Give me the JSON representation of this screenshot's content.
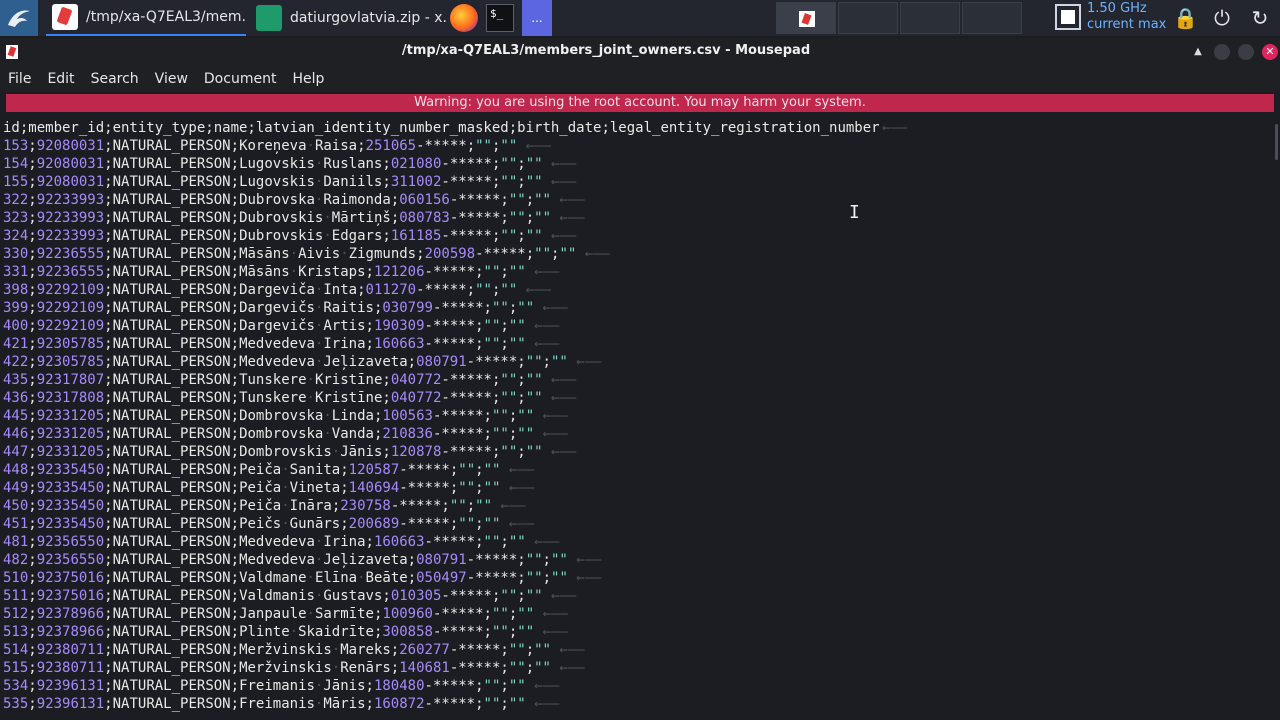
{
  "taskbar": {
    "tasks": [
      {
        "label": "/tmp/xa-Q7EAL3/mem..."
      },
      {
        "label": "datiurgovlatvia.zip - x..."
      }
    ],
    "terminal_glyph": "$_",
    "extra_label": "...",
    "cpu_freq": "1.50 GHz",
    "cpu_mode": "current max",
    "icons": [
      "kali-dragon-icon",
      "mousepad-icon",
      "archive-icon",
      "firefox-icon",
      "terminal-icon",
      "lock-icon",
      "power-icon",
      "refresh-icon"
    ]
  },
  "window": {
    "title": "/tmp/xa-Q7EAL3/members_joint_owners.csv - Mousepad"
  },
  "menu": [
    "File",
    "Edit",
    "Search",
    "View",
    "Document",
    "Help"
  ],
  "warning": "Warning: you are using the root account. You may harm your system.",
  "editor": {
    "header": "id;member_id;entity_type;name;latvian_identity_number_masked;birth_date;legal_entity_registration_number",
    "rows": [
      [
        "153",
        "92080031",
        "NATURAL_PERSON",
        "Koreņeva Raisa",
        "251065-*****"
      ],
      [
        "154",
        "92080031",
        "NATURAL_PERSON",
        "Lugovskis Ruslans",
        "021080-*****"
      ],
      [
        "155",
        "92080031",
        "NATURAL_PERSON",
        "Lugovskis Daniils",
        "311002-*****"
      ],
      [
        "322",
        "92233993",
        "NATURAL_PERSON",
        "Dubrovska Raimonda",
        "060156-*****"
      ],
      [
        "323",
        "92233993",
        "NATURAL_PERSON",
        "Dubrovskis Mārtiņš",
        "080783-*****"
      ],
      [
        "324",
        "92233993",
        "NATURAL_PERSON",
        "Dubrovskis Edgars",
        "161185-*****"
      ],
      [
        "330",
        "92236555",
        "NATURAL_PERSON",
        "Māsāns Aivis Zigmunds",
        "200598-*****"
      ],
      [
        "331",
        "92236555",
        "NATURAL_PERSON",
        "Māsāns Kristaps",
        "121206-*****"
      ],
      [
        "398",
        "92292109",
        "NATURAL_PERSON",
        "Dargeviča Inta",
        "011270-*****"
      ],
      [
        "399",
        "92292109",
        "NATURAL_PERSON",
        "Dargevičs Raitis",
        "030799-*****"
      ],
      [
        "400",
        "92292109",
        "NATURAL_PERSON",
        "Dargevičs Artis",
        "190309-*****"
      ],
      [
        "421",
        "92305785",
        "NATURAL_PERSON",
        "Medvedeva Irina",
        "160663-*****"
      ],
      [
        "422",
        "92305785",
        "NATURAL_PERSON",
        "Medvedeva Jeļizaveta",
        "080791-*****"
      ],
      [
        "435",
        "92317807",
        "NATURAL_PERSON",
        "Tunskere Kristīne",
        "040772-*****"
      ],
      [
        "436",
        "92317808",
        "NATURAL_PERSON",
        "Tunskere Kristīne",
        "040772-*****"
      ],
      [
        "445",
        "92331205",
        "NATURAL_PERSON",
        "Dombrovska Linda",
        "100563-*****"
      ],
      [
        "446",
        "92331205",
        "NATURAL_PERSON",
        "Dombrovska Vanda",
        "210836-*****"
      ],
      [
        "447",
        "92331205",
        "NATURAL_PERSON",
        "Dombrovskis Jānis",
        "120878-*****"
      ],
      [
        "448",
        "92335450",
        "NATURAL_PERSON",
        "Peiča Sanita",
        "120587-*****"
      ],
      [
        "449",
        "92335450",
        "NATURAL_PERSON",
        "Peiča Vineta",
        "140694-*****"
      ],
      [
        "450",
        "92335450",
        "NATURAL_PERSON",
        "Peiča Ināra",
        "230758-*****"
      ],
      [
        "451",
        "92335450",
        "NATURAL_PERSON",
        "Peičs Gunārs",
        "200689-*****"
      ],
      [
        "481",
        "92356550",
        "NATURAL_PERSON",
        "Medvedeva Irina",
        "160663-*****"
      ],
      [
        "482",
        "92356550",
        "NATURAL_PERSON",
        "Medvedeva Jeļizaveta",
        "080791-*****"
      ],
      [
        "510",
        "92375016",
        "NATURAL_PERSON",
        "Valdmane Elīna Beāte",
        "050497-*****"
      ],
      [
        "511",
        "92375016",
        "NATURAL_PERSON",
        "Valdmanis Gustavs",
        "010305-*****"
      ],
      [
        "512",
        "92378966",
        "NATURAL_PERSON",
        "Janpaule Sarmīte",
        "100960-*****"
      ],
      [
        "513",
        "92378966",
        "NATURAL_PERSON",
        "Plinte Skaidrīte",
        "300858-*****"
      ],
      [
        "514",
        "92380711",
        "NATURAL_PERSON",
        "Meržvinskis Mareks",
        "260277-*****"
      ],
      [
        "515",
        "92380711",
        "NATURAL_PERSON",
        "Meržvinskis Renārs",
        "140681-*****"
      ],
      [
        "534",
        "92396131",
        "NATURAL_PERSON",
        "Freimanis Jānis",
        "180480-*****"
      ],
      [
        "535",
        "92396131",
        "NATURAL_PERSON",
        "Freimanis Māris",
        "160872-*****"
      ]
    ]
  }
}
